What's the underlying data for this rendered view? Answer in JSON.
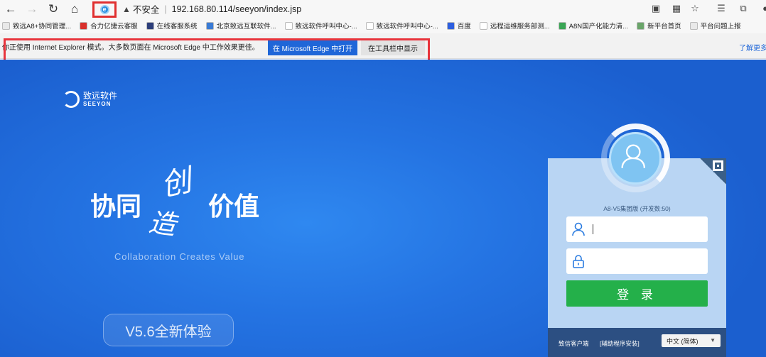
{
  "browser": {
    "not_secure_label": "不安全",
    "url": "192.168.80.114/seeyon/index.jsp"
  },
  "bookmarks": [
    {
      "label": "致远A8+协同管理...",
      "color": "#e9e9e9"
    },
    {
      "label": "合力亿捷云客服",
      "color": "#d9302c"
    },
    {
      "label": "在线客服系统",
      "color": "#2c3e7a"
    },
    {
      "label": "北京致远互联软件...",
      "color": "#3a7bd5"
    },
    {
      "label": "致远软件呼叫中心-...",
      "color": "#ffffff"
    },
    {
      "label": "致远软件呼叫中心-...",
      "color": "#ffffff"
    },
    {
      "label": "百度",
      "color": "#2d5fe0"
    },
    {
      "label": "远程运维服务部测...",
      "color": "#ffffff"
    },
    {
      "label": "A8N国产化能力清...",
      "color": "#3aa655"
    },
    {
      "label": "新平台首页",
      "color": "#6aa56a"
    },
    {
      "label": "平台问题上报",
      "color": "#e9e9e9"
    }
  ],
  "ie_mode_bar": {
    "message": "你正使用 Internet Explorer 模式。大多数页面在 Microsoft Edge 中工作效果更佳。",
    "open_in_edge_label": "在 Microsoft Edge 中打开",
    "show_in_toolbar_label": "在工具栏中显示",
    "learn_more_label": "了解更多"
  },
  "page": {
    "brand_cn": "致远软件",
    "brand_en": "SEEYON",
    "slogan_left": "协同",
    "slogan_callig_top": "创",
    "slogan_callig_bottom": "造",
    "slogan_right": "价值",
    "slogan_en": "Collaboration Creates Value",
    "version_badge": "V5.6全新体验"
  },
  "login": {
    "edition": "A8-V5集团版 (开发数:50)",
    "username_value": "",
    "password_value": "",
    "login_label": "登 录",
    "client_link": "致信客户端",
    "helper_link": "[辅助程序安装]",
    "language": "中文 (简体)"
  },
  "colors": {
    "page_bg": "#2473e2",
    "login_button": "#24b04a",
    "panel_footer": "#2c4f82",
    "highlight_box": "#e8343c"
  }
}
